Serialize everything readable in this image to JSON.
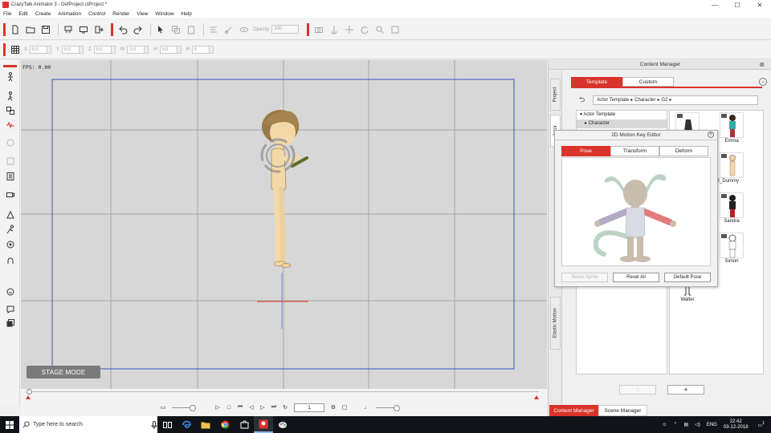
{
  "window": {
    "title": "CrazyTalk Animator 3  - DefProject.ctProject *",
    "minimize": "—",
    "maximize": "☐",
    "close": "✕"
  },
  "menu": [
    "File",
    "Edit",
    "Create",
    "Animation",
    "Control",
    "Render",
    "View",
    "Window",
    "Help"
  ],
  "toolbar": {
    "opacity_label": "Opacity",
    "opacity_value": "100"
  },
  "transform_fields": [
    {
      "label": "X",
      "value": "0.0"
    },
    {
      "label": "Y",
      "value": "0.0"
    },
    {
      "label": "Z",
      "value": "0.0"
    },
    {
      "label": "W",
      "value": "0.0"
    },
    {
      "label": "H",
      "value": "0.0"
    },
    {
      "label": "R",
      "value": "0"
    }
  ],
  "stage": {
    "fps": "FPS: 0.00",
    "mode_label": "STAGE MODE"
  },
  "timeline": {
    "frame": "1"
  },
  "content_manager": {
    "title": "Content Manager",
    "side_tabs": [
      "Project",
      "Actor",
      "Elastic Motion"
    ],
    "tabs": [
      "Template",
      "Custom"
    ],
    "breadcrumb": [
      "Actor Template",
      "▸",
      "Character",
      "▸",
      "G2",
      "▸"
    ],
    "tree": [
      "Actor Template",
      "Character"
    ],
    "items": [
      "Emma",
      "G2_Dummy",
      "Sandra",
      "Simon",
      "Walter"
    ],
    "add_label": "+",
    "down_label": "↓"
  },
  "manager_tabs": [
    "Content Manager",
    "Scene Manager"
  ],
  "motion_key_editor": {
    "title": "2D Motion Key Editor",
    "tabs": [
      "Pose",
      "Transform",
      "Deform"
    ],
    "buttons": [
      "Reset Sprite",
      "Reset All",
      "Default Pose"
    ]
  },
  "taskbar": {
    "search_placeholder": "Type here to search",
    "lang": "ENG",
    "time": "22:42",
    "date": "03-12-2018",
    "notification_count": "1"
  },
  "colors": {
    "accent": "#d9342b",
    "stage_bg": "#d7d7d7",
    "frame_border": "#3a55b8"
  }
}
